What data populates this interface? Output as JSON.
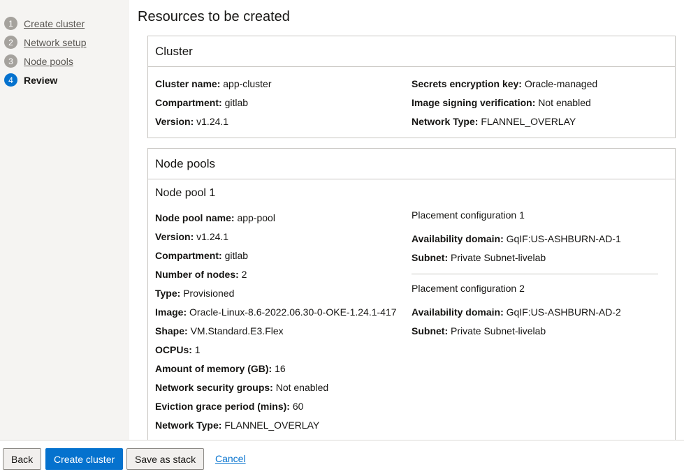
{
  "steps": [
    {
      "num": "1",
      "label": "Create cluster"
    },
    {
      "num": "2",
      "label": "Network setup"
    },
    {
      "num": "3",
      "label": "Node pools"
    },
    {
      "num": "4",
      "label": "Review"
    }
  ],
  "page_title": "Resources to be created",
  "cluster": {
    "title": "Cluster",
    "left": [
      {
        "k": "Cluster name:",
        "v": "app-cluster"
      },
      {
        "k": "Compartment:",
        "v": "gitlab"
      },
      {
        "k": "Version:",
        "v": "v1.24.1"
      }
    ],
    "right": [
      {
        "k": "Secrets encryption key:",
        "v": "Oracle-managed"
      },
      {
        "k": "Image signing verification:",
        "v": "Not enabled"
      },
      {
        "k": "Network Type:",
        "v": "FLANNEL_OVERLAY"
      }
    ]
  },
  "node_pools": {
    "title": "Node pools",
    "pool_title": "Node pool 1",
    "fields": [
      {
        "k": "Node pool name:",
        "v": "app-pool"
      },
      {
        "k": "Version:",
        "v": "v1.24.1"
      },
      {
        "k": "Compartment:",
        "v": "gitlab"
      },
      {
        "k": "Number of nodes:",
        "v": "2"
      },
      {
        "k": "Type:",
        "v": "Provisioned"
      },
      {
        "k": "Image:",
        "v": "Oracle-Linux-8.6-2022.06.30-0-OKE-1.24.1-417"
      },
      {
        "k": "Shape:",
        "v": "VM.Standard.E3.Flex"
      },
      {
        "k": "OCPUs:",
        "v": "1"
      },
      {
        "k": "Amount of memory (GB):",
        "v": "16"
      },
      {
        "k": "Network security groups:",
        "v": "Not enabled"
      },
      {
        "k": "Eviction grace period (mins):",
        "v": "60"
      },
      {
        "k": "Network Type:",
        "v": "FLANNEL_OVERLAY"
      }
    ],
    "placements": [
      {
        "title": "Placement configuration 1",
        "ad": {
          "k": "Availability domain:",
          "v": "GqIF:US-ASHBURN-AD-1"
        },
        "subnet": {
          "k": "Subnet:",
          "v": "Private Subnet-livelab"
        }
      },
      {
        "title": "Placement configuration 2",
        "ad": {
          "k": "Availability domain:",
          "v": "GqIF:US-ASHBURN-AD-2"
        },
        "subnet": {
          "k": "Subnet:",
          "v": "Private Subnet-livelab"
        }
      }
    ]
  },
  "footer": {
    "back_label": "Back",
    "create_label": "Create cluster",
    "stack_label": "Save as stack",
    "cancel_label": "Cancel"
  },
  "colors": {
    "accent": "#0572ce",
    "step_inactive": "#a5a29d"
  }
}
